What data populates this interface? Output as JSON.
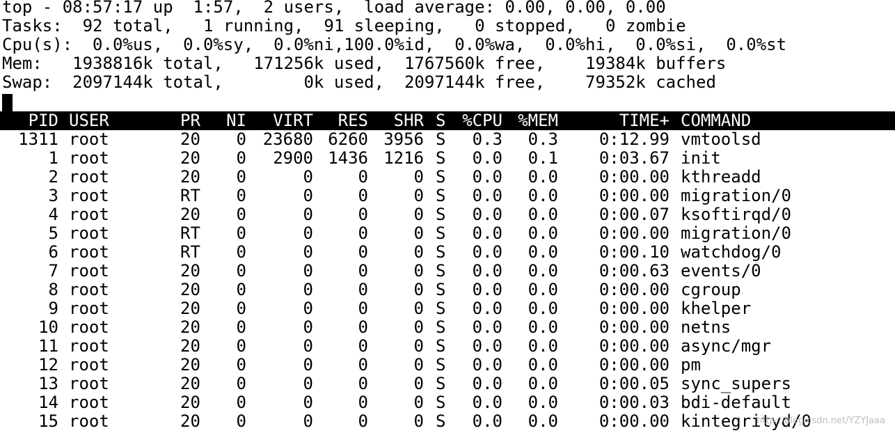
{
  "summary": {
    "line1": "top - 08:57:17 up  1:57,  2 users,  load average: 0.00, 0.00, 0.00",
    "line2": "Tasks:  92 total,   1 running,  91 sleeping,   0 stopped,   0 zombie",
    "line3": "Cpu(s):  0.0%us,  0.0%sy,  0.0%ni,100.0%id,  0.0%wa,  0.0%hi,  0.0%si,  0.0%st",
    "line4": "Mem:   1938816k total,   171256k used,  1767560k free,    19384k buffers",
    "line5": "Swap:  2097144k total,        0k used,  2097144k free,    79352k cached"
  },
  "table": {
    "columns": [
      "PID",
      "USER",
      "PR",
      "NI",
      "VIRT",
      "RES",
      "SHR",
      "S",
      "%CPU",
      "%MEM",
      "TIME+",
      "COMMAND"
    ],
    "rows": [
      [
        "1311",
        "root",
        "20",
        "0",
        "23680",
        "6260",
        "3956",
        "S",
        "0.3",
        "0.3",
        "0:12.99",
        "vmtoolsd"
      ],
      [
        "1",
        "root",
        "20",
        "0",
        "2900",
        "1436",
        "1216",
        "S",
        "0.0",
        "0.1",
        "0:03.67",
        "init"
      ],
      [
        "2",
        "root",
        "20",
        "0",
        "0",
        "0",
        "0",
        "S",
        "0.0",
        "0.0",
        "0:00.00",
        "kthreadd"
      ],
      [
        "3",
        "root",
        "RT",
        "0",
        "0",
        "0",
        "0",
        "S",
        "0.0",
        "0.0",
        "0:00.00",
        "migration/0"
      ],
      [
        "4",
        "root",
        "20",
        "0",
        "0",
        "0",
        "0",
        "S",
        "0.0",
        "0.0",
        "0:00.07",
        "ksoftirqd/0"
      ],
      [
        "5",
        "root",
        "RT",
        "0",
        "0",
        "0",
        "0",
        "S",
        "0.0",
        "0.0",
        "0:00.00",
        "migration/0"
      ],
      [
        "6",
        "root",
        "RT",
        "0",
        "0",
        "0",
        "0",
        "S",
        "0.0",
        "0.0",
        "0:00.10",
        "watchdog/0"
      ],
      [
        "7",
        "root",
        "20",
        "0",
        "0",
        "0",
        "0",
        "S",
        "0.0",
        "0.0",
        "0:00.63",
        "events/0"
      ],
      [
        "8",
        "root",
        "20",
        "0",
        "0",
        "0",
        "0",
        "S",
        "0.0",
        "0.0",
        "0:00.00",
        "cgroup"
      ],
      [
        "9",
        "root",
        "20",
        "0",
        "0",
        "0",
        "0",
        "S",
        "0.0",
        "0.0",
        "0:00.00",
        "khelper"
      ],
      [
        "10",
        "root",
        "20",
        "0",
        "0",
        "0",
        "0",
        "S",
        "0.0",
        "0.0",
        "0:00.00",
        "netns"
      ],
      [
        "11",
        "root",
        "20",
        "0",
        "0",
        "0",
        "0",
        "S",
        "0.0",
        "0.0",
        "0:00.00",
        "async/mgr"
      ],
      [
        "12",
        "root",
        "20",
        "0",
        "0",
        "0",
        "0",
        "S",
        "0.0",
        "0.0",
        "0:00.00",
        "pm"
      ],
      [
        "13",
        "root",
        "20",
        "0",
        "0",
        "0",
        "0",
        "S",
        "0.0",
        "0.0",
        "0:00.05",
        "sync_supers"
      ],
      [
        "14",
        "root",
        "20",
        "0",
        "0",
        "0",
        "0",
        "S",
        "0.0",
        "0.0",
        "0:00.03",
        "bdi-default"
      ],
      [
        "15",
        "root",
        "20",
        "0",
        "0",
        "0",
        "0",
        "S",
        "0.0",
        "0.0",
        "0:00.00",
        "kintegrityd/0"
      ]
    ]
  },
  "watermark": "http://blog.csdn.net/YZYJaaa",
  "colors": {
    "background": "#ffffff",
    "text": "#000000",
    "header_bar": "#000000",
    "header_text": "#ffffff"
  }
}
